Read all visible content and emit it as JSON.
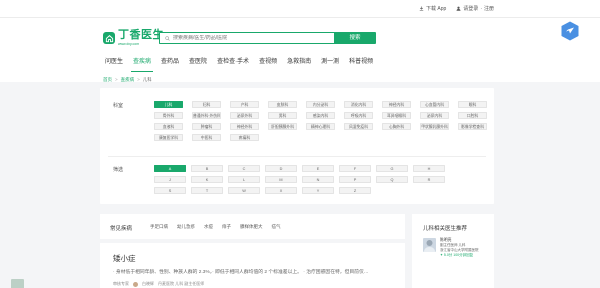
{
  "topbar": {
    "download_label": "下载 App",
    "login_label": "请登录",
    "divider": "·",
    "register_label": "注册"
  },
  "header": {
    "logo_text": "丁香医生",
    "logo_sub": "www.dxy.com",
    "search_placeholder": "搜索疾病/医生/药品/医院",
    "search_button": "搜索",
    "brand_color": "#19a86b"
  },
  "nav": [
    {
      "label": "问医生",
      "active": false
    },
    {
      "label": "查疾病",
      "active": true
    },
    {
      "label": "查药品",
      "active": false
    },
    {
      "label": "查医院",
      "active": false
    },
    {
      "label": "查检查·手术",
      "active": false
    },
    {
      "label": "查视频",
      "active": false
    },
    {
      "label": "急救指南",
      "active": false
    },
    {
      "label": "測一测",
      "active": false
    },
    {
      "label": "科普视频",
      "active": false
    }
  ],
  "breadcrumb": {
    "home": "首页",
    "sep1": ">",
    "level2": "查疾病",
    "sep2": ">",
    "current": "儿科"
  },
  "filters": {
    "department_label": "科室",
    "departments": [
      "儿科",
      "妇科",
      "产科",
      "皮肤科",
      "内分泌科",
      "消化内科",
      "神经内科",
      "心血管内科",
      "眼科",
      "骨外科",
      "普通外科·外伤科",
      "泌尿外科",
      "男科",
      "感染内科",
      "呼吸内科",
      "耳鼻咽喉科",
      "泌尿内科",
      "口腔科",
      "血液科",
      "肿瘤科",
      "神经外科",
      "肝胆胰腺外科",
      "精神心理科",
      "风湿免疫科",
      "心胸外科",
      "甲状腺乳腺外科",
      "影像学检查科",
      "康复医学科",
      "中医科",
      "疼痛科"
    ],
    "filter_label": "筛选",
    "letters": [
      "A",
      "B",
      "C",
      "D",
      "E",
      "F",
      "G",
      "H",
      "J",
      "K",
      "L",
      "M",
      "N",
      "P",
      "Q",
      "R",
      "S",
      "T",
      "W",
      "X",
      "Y",
      "Z"
    ]
  },
  "disease_bar": {
    "title": "常见疾病",
    "tags": [
      "手足口病",
      "幼儿急疹",
      "水痘",
      "痱子",
      "腺样体肥大",
      "疝气"
    ]
  },
  "article": {
    "title": "矮小症",
    "summary": "· 身材低于相同年龄、性别、种族人群的 2.3%，· 即低于相同人群均值的 2 个标准差以上。 · 治疗困惑因在特，但目前仅…",
    "author_prefix": "审核专家",
    "author": "白晓辉",
    "author_title": "丹麦医院 儿科 副主任医师"
  },
  "side": {
    "title": "儿科相关医生推荐",
    "doctor_name": "陈明亮",
    "doctor_title": "副主任医师 儿科",
    "doctor_hospital": "浙江省中山大学附属医院",
    "doctor_stats": "✦ 5.0分  100分钟回复"
  }
}
